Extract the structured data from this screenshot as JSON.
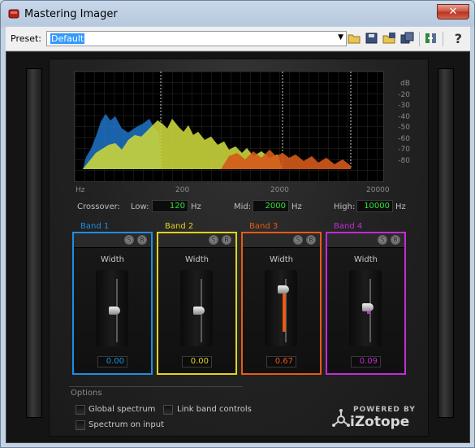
{
  "window": {
    "title": "Mastering Imager",
    "close_glyph": "✕"
  },
  "toolbar": {
    "preset_label": "Preset:",
    "preset_value": "Default",
    "icons": [
      "open-folder-icon",
      "save-icon",
      "save-as-icon",
      "copy-icon",
      "compare-icon"
    ],
    "help_label": "?"
  },
  "spectrum": {
    "db_unit": "dB",
    "db_ticks": [
      "-20",
      "-30",
      "-40",
      "-50",
      "-60",
      "-70",
      "-80"
    ],
    "freq_unit": "Hz",
    "freq_ticks": [
      "200",
      "2000",
      "20000"
    ],
    "colors": {
      "band1": "#1e73c8",
      "band2": "#c9d43c",
      "band3": "#d4591a"
    }
  },
  "crossover": {
    "label": "Crossover:",
    "low_label": "Low:",
    "low_value": "120",
    "mid_label": "Mid:",
    "mid_value": "2000",
    "high_label": "High:",
    "high_value": "10000",
    "unit": "Hz"
  },
  "bands": [
    {
      "title": "Band 1",
      "width_label": "Width",
      "value": "0.00",
      "width_fraction": 0.0,
      "color": "#1e8ee0",
      "solo": "S",
      "bypass": "B"
    },
    {
      "title": "Band 2",
      "width_label": "Width",
      "value": "0.00",
      "width_fraction": 0.0,
      "color": "#e3d21d",
      "solo": "S",
      "bypass": "B"
    },
    {
      "title": "Band 3",
      "width_label": "Width",
      "value": "0.67",
      "width_fraction": 0.67,
      "color": "#ea5a14",
      "solo": "S",
      "bypass": "B"
    },
    {
      "title": "Band 4",
      "width_label": "Width",
      "value": "0.09",
      "width_fraction": 0.09,
      "color": "#c42bd7",
      "solo": "S",
      "bypass": "B"
    }
  ],
  "options": {
    "title": "Options",
    "global_spectrum": "Global spectrum",
    "link_band_controls": "Link band controls",
    "spectrum_on_input": "Spectrum on input"
  },
  "logo": {
    "powered": "POWERED BY",
    "brand": "iZotope"
  }
}
